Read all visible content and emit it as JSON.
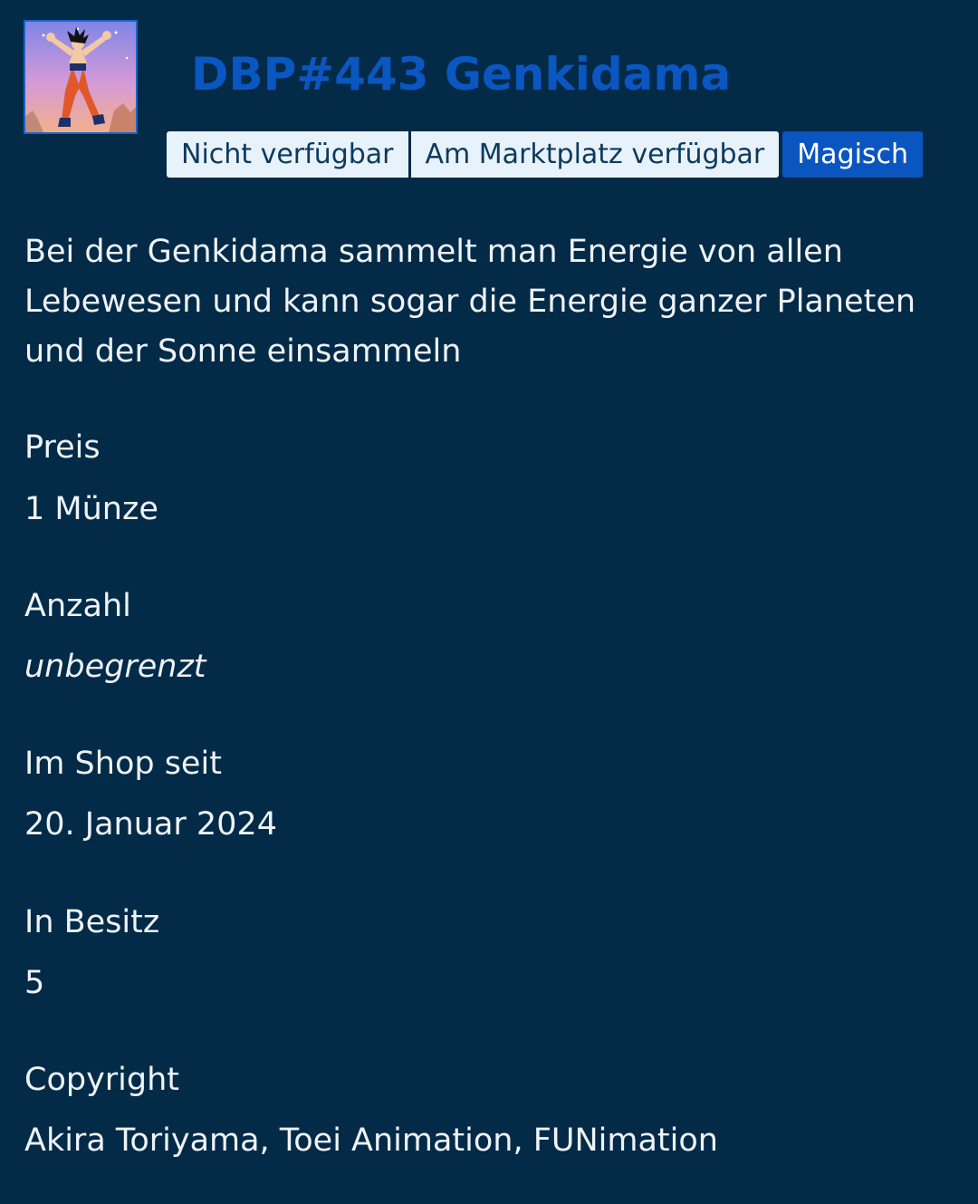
{
  "item": {
    "title": "DBP#443 Genkidama",
    "badges": [
      {
        "label": "Nicht verfügbar"
      },
      {
        "label": "Am Marktplatz verfügbar"
      },
      {
        "label": "Magisch"
      }
    ],
    "description": "Bei der Genkidama sammelt man Energie von allen Lebewesen und kann sogar die Energie ganzer Planeten und der Sonne einsammeln"
  },
  "fields": {
    "price": {
      "label": "Preis",
      "value": "1 Münze"
    },
    "quantity": {
      "label": "Anzahl",
      "value": "unbegrenzt"
    },
    "since": {
      "label": "Im Shop seit",
      "value": "20. Januar 2024"
    },
    "owned": {
      "label": "In Besitz",
      "value": "5"
    },
    "copyright": {
      "label": "Copyright",
      "value": "Akira Toriyama, Toei Animation, FUNimation"
    }
  },
  "colors": {
    "background": "#032a47",
    "title": "#0a57c2",
    "badge_light": "#e8f2fb",
    "badge_accent": "#0a55c0",
    "text": "#eef3f8"
  },
  "image": {
    "icon": "goku-spirit-bomb-image"
  }
}
